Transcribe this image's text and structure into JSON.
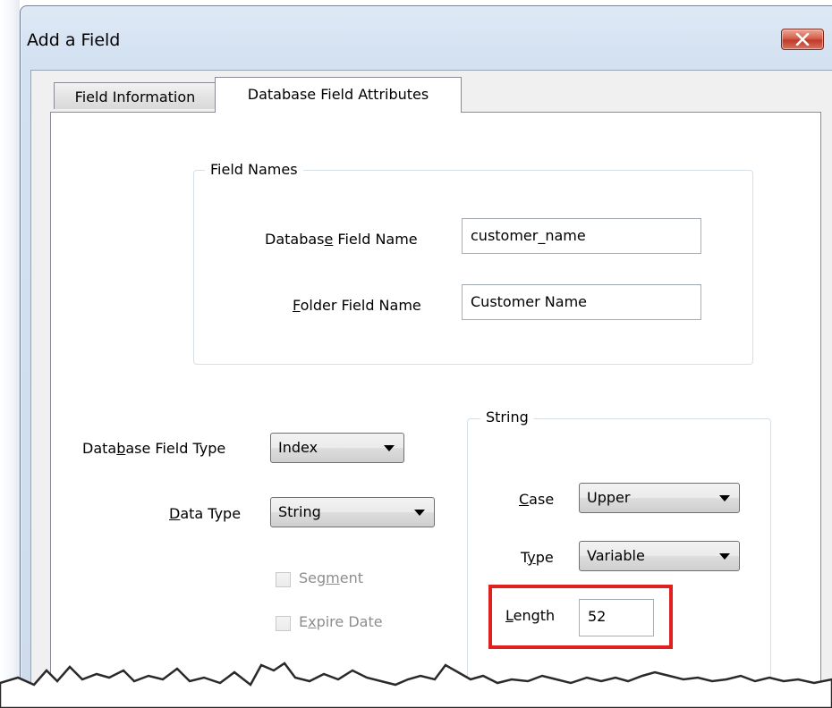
{
  "window": {
    "title": "Add a Field"
  },
  "tabs": [
    {
      "label": "Field Information",
      "active": false
    },
    {
      "label": "Database Field Attributes",
      "active": true
    }
  ],
  "field_names_group": {
    "legend": "Field Names",
    "database_field_name": {
      "label_pre": "Databas",
      "label_mnemonic": "e",
      "label_post": " Field Name",
      "value": "customer_name"
    },
    "folder_field_name": {
      "label_pre": "",
      "label_mnemonic": "F",
      "label_post": "older Field Name",
      "value": "Customer Name"
    }
  },
  "left_fields": {
    "database_field_type": {
      "label_pre": "Data",
      "label_mnemonic": "b",
      "label_post": "ase Field Type",
      "selected": "Index"
    },
    "data_type": {
      "label_pre": "",
      "label_mnemonic": "D",
      "label_post": "ata Type",
      "selected": "String"
    },
    "segment": {
      "label_pre": "Seg",
      "label_mnemonic": "m",
      "label_post": "ent",
      "checked": false,
      "enabled": false
    },
    "expire_date": {
      "label_pre": "E",
      "label_mnemonic": "x",
      "label_post": "pire Date",
      "checked": false,
      "enabled": false
    }
  },
  "string_group": {
    "legend": "String",
    "case": {
      "label_pre": "",
      "label_mnemonic": "C",
      "label_post": "ase",
      "selected": "Upper"
    },
    "type": {
      "label_pre": "T",
      "label_mnemonic": "y",
      "label_post": "pe",
      "selected": "Variable"
    },
    "length": {
      "label_pre": "",
      "label_mnemonic": "L",
      "label_post": "ength",
      "value": "52"
    }
  },
  "colors": {
    "highlight": "#e0201e",
    "close_button": "#c0392b"
  },
  "icons": {
    "close": "close-x-icon",
    "dropdown": "chevron-down-icon"
  }
}
